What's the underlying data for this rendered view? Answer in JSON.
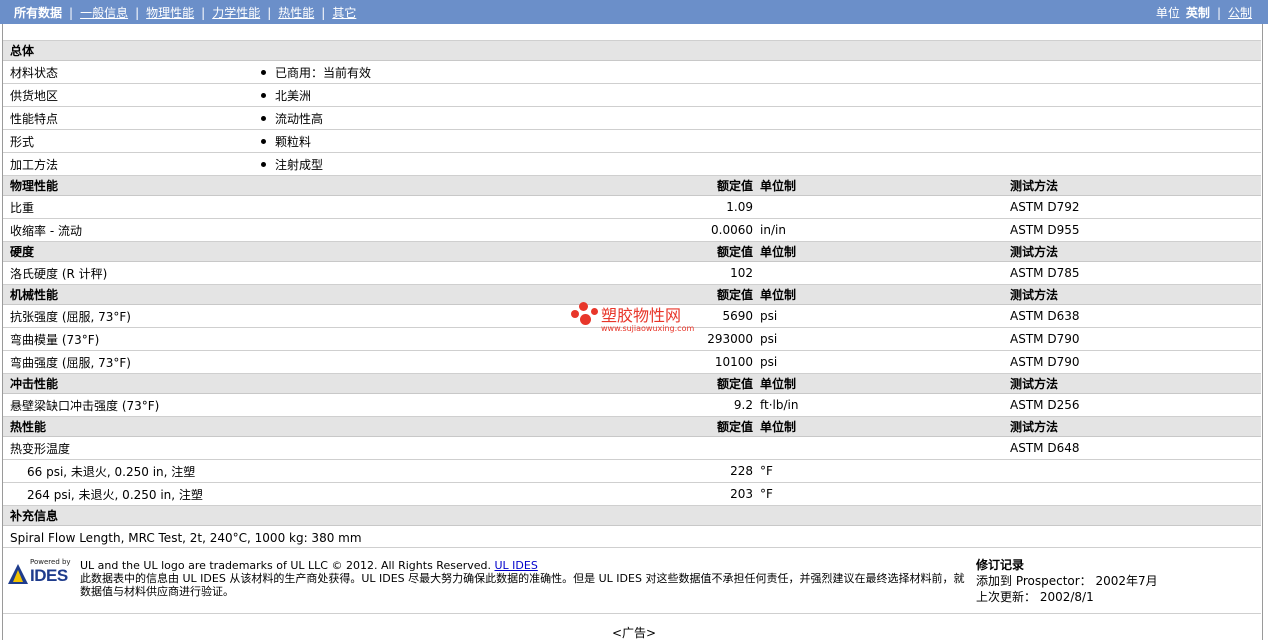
{
  "nav": {
    "tabs": [
      "所有数据",
      "一般信息",
      "物理性能",
      "力学性能",
      "热性能",
      "其它"
    ],
    "units_label": "单位",
    "unit_active": "英制",
    "unit_other": "公制"
  },
  "general": {
    "title": "总体",
    "rows": [
      {
        "name": "材料状态",
        "value": "已商用：当前有效"
      },
      {
        "name": "供货地区",
        "value": "北美洲"
      },
      {
        "name": "性能特点",
        "value": "流动性高"
      },
      {
        "name": "形式",
        "value": "颗粒料"
      },
      {
        "name": "加工方法",
        "value": "注射成型"
      }
    ]
  },
  "column_headers": {
    "value": "额定值",
    "unit": "单位制",
    "method": "测试方法"
  },
  "physical": {
    "title": "物理性能",
    "rows": [
      {
        "name": "比重",
        "value": "1.09",
        "unit": "",
        "method": "ASTM D792"
      },
      {
        "name": "收缩率 - 流动",
        "value": "0.0060",
        "unit": "in/in",
        "method": "ASTM D955"
      }
    ]
  },
  "hardness": {
    "title": "硬度",
    "rows": [
      {
        "name": "洛氏硬度 (R 计秤)",
        "value": "102",
        "unit": "",
        "method": "ASTM D785"
      }
    ]
  },
  "mechanical": {
    "title": "机械性能",
    "rows": [
      {
        "name": "抗张强度 (屈服, 73°F)",
        "value": "5690",
        "unit": "psi",
        "method": "ASTM D638"
      },
      {
        "name": "弯曲模量 (73°F)",
        "value": "293000",
        "unit": "psi",
        "method": "ASTM D790"
      },
      {
        "name": "弯曲强度 (屈服, 73°F)",
        "value": "10100",
        "unit": "psi",
        "method": "ASTM D790"
      }
    ]
  },
  "impact": {
    "title": "冲击性能",
    "rows": [
      {
        "name": "悬壁梁缺口冲击强度 (73°F)",
        "value": "9.2",
        "unit": "ft·lb/in",
        "method": "ASTM D256"
      }
    ]
  },
  "thermal": {
    "title": "热性能",
    "rows": [
      {
        "name": "热变形温度",
        "value": "",
        "unit": "",
        "method": "ASTM D648"
      },
      {
        "name": "66 psi, 未退火, 0.250 in, 注塑",
        "value": "228",
        "unit": "°F",
        "method": ""
      },
      {
        "name": "264 psi, 未退火, 0.250 in, 注塑",
        "value": "203",
        "unit": "°F",
        "method": ""
      }
    ]
  },
  "supplement": {
    "title": "补充信息",
    "text": "Spiral Flow Length, MRC Test, 2t, 240°C, 1000 kg: 380 mm"
  },
  "watermark": {
    "title": "塑胶物性网",
    "url": "www.sujiaowuxing.com"
  },
  "footer": {
    "logo_small": "Powered by",
    "logo_text": "IDES",
    "trademark": "UL and the UL logo are trademarks of UL LLC © 2012. All Rights Reserved.",
    "link": "UL IDES",
    "disclaimer": "此数据表中的信息由 UL IDES 从该材料的生产商处获得。UL IDES 尽最大努力确保此数据的准确性。但是 UL IDES 对这些数据值不承担任何责任，并强烈建议在最终选择材料前，就数据值与材料供应商进行验证。",
    "revision_title": "修订记录",
    "added": "添加到 Prospector： 2002年7月",
    "updated": "上次更新： 2002/8/1",
    "ad": "<广告>"
  },
  "colors": {
    "nav_bg": "#6b8fc9",
    "section_bg": "#e4e4e4",
    "watermark": "#e8362a",
    "ides_blue": "#1f3c8c"
  }
}
